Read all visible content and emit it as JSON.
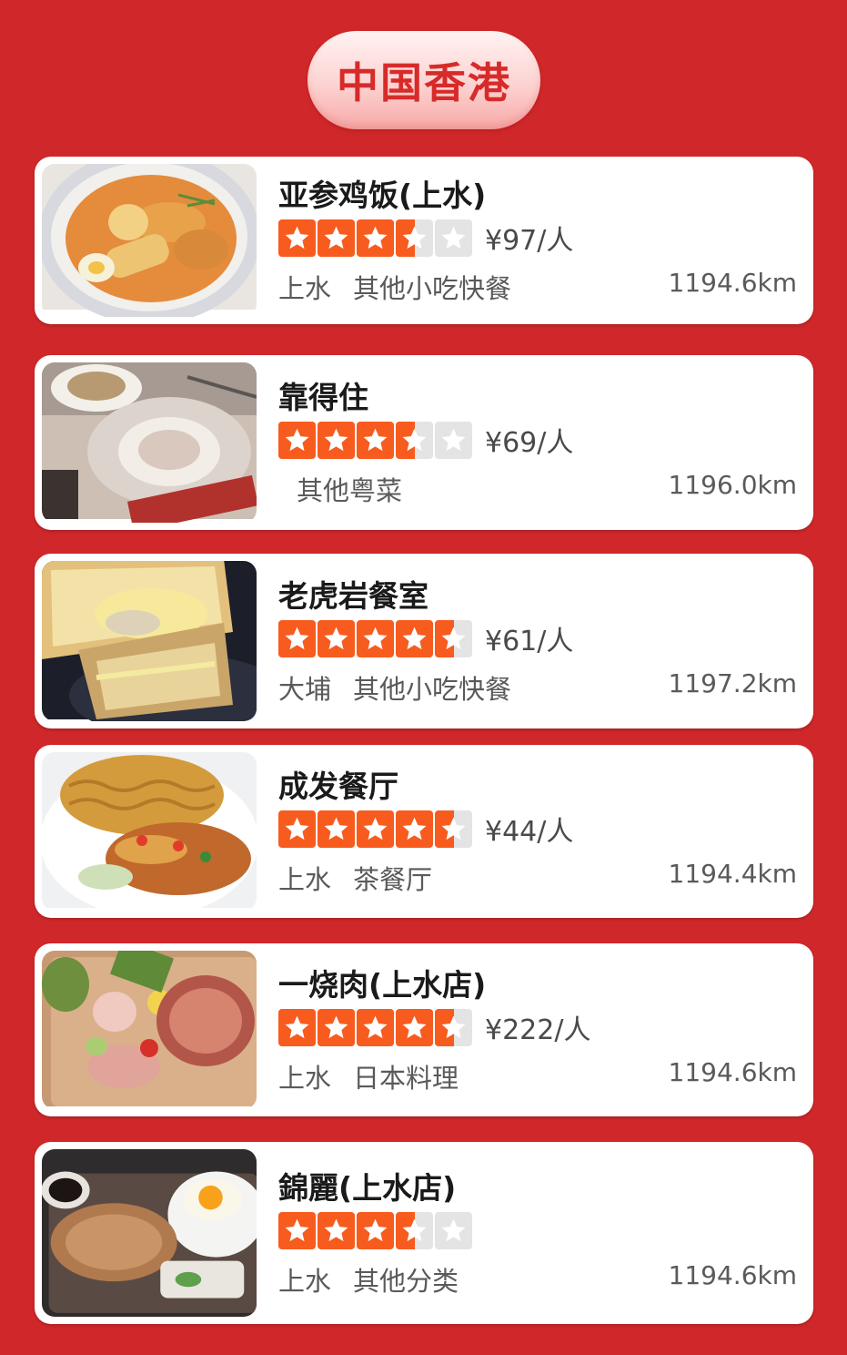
{
  "region": "中国香港",
  "colors": {
    "background": "#d0282a",
    "star_active": "#f85b1e",
    "star_inactive": "#e4e4e4",
    "region_text": "#d62b2a"
  },
  "restaurants": [
    {
      "name": "亚参鸡饭(上水)",
      "rating": 3.5,
      "price": "¥97/人",
      "area": "上水",
      "category": "其他小吃快餐",
      "distance": "1194.6km",
      "thumb": "laksa-bowl"
    },
    {
      "name": "靠得住",
      "rating": 3.5,
      "price": "¥69/人",
      "area": "",
      "category": "其他粤菜",
      "distance": "1196.0km",
      "thumb": "dim-sum-table"
    },
    {
      "name": "老虎岩餐室",
      "rating": 4.5,
      "price": "¥61/人",
      "area": "大埔",
      "category": "其他小吃快餐",
      "distance": "1197.2km",
      "thumb": "egg-toast"
    },
    {
      "name": "成发餐厅",
      "rating": 4.5,
      "price": "¥44/人",
      "area": "上水",
      "category": "茶餐厅",
      "distance": "1194.4km",
      "thumb": "noodle-plate"
    },
    {
      "name": "一烧肉(上水店)",
      "rating": 4.5,
      "price": "¥222/人",
      "area": "上水",
      "category": "日本料理",
      "distance": "1194.6km",
      "thumb": "yakiniku-platter"
    },
    {
      "name": "錦麗(上水店)",
      "rating": 3.5,
      "price": "",
      "area": "上水",
      "category": "其他分类",
      "distance": "1194.6km",
      "thumb": "pork-chop-rice"
    }
  ]
}
